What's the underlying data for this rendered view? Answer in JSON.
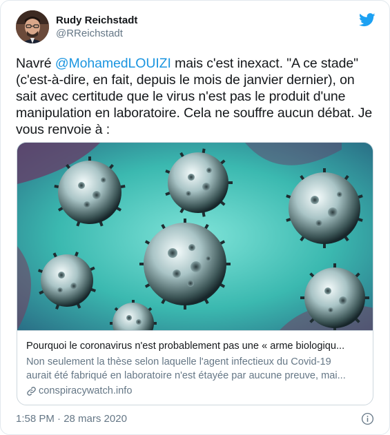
{
  "tweet": {
    "author": {
      "display_name": "Rudy Reichstadt",
      "handle": "@RReichstadt",
      "avatar_icon": "avatar"
    },
    "text_prefix": "Navré ",
    "mention": "@MohamedLOUIZI",
    "text_suffix": " mais c'est inexact. \"A ce stade\" (c'est-à-dire, en fait, depuis le mois de janvier dernier), on sait avec certitude que le virus n'est pas le produit d'une manipulation en laboratoire. Cela ne souffre aucun débat. Je vous renvoie à :",
    "card": {
      "image_icon": "coronavirus-illustration",
      "title": "Pourquoi le coronavirus n'est probablement pas une « arme biologiqu...",
      "description_line1": "Non seulement la thèse selon laquelle l'agent infectieux du Covid-19",
      "description_line2": "aurait été fabriqué en laboratoire n'est étayée par aucune preuve, mai...",
      "domain": "conspiracywatch.info"
    },
    "timestamp": "1:58 PM · 28 mars 2020"
  },
  "colors": {
    "link": "#1b95e0",
    "twitter_blue": "#1da1f2",
    "secondary_text": "#657786",
    "border": "#ccd6dd"
  }
}
